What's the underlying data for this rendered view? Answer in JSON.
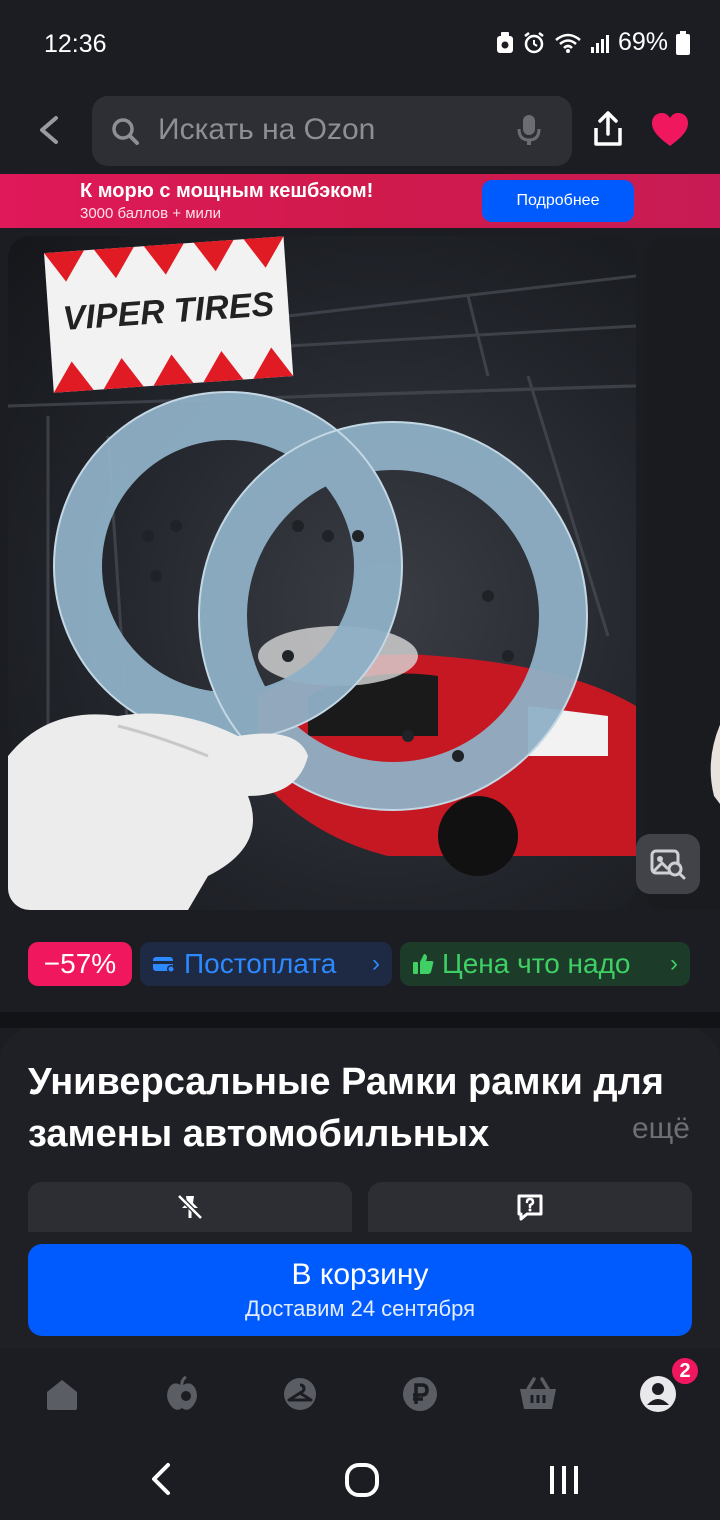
{
  "status_bar": {
    "time": "12:36",
    "battery": "69%"
  },
  "search": {
    "placeholder": "Искать на Ozon"
  },
  "promo": {
    "title": "К морю с мощным кешбэком!",
    "subtitle": "3000 баллов + мили",
    "button": "Подробнее"
  },
  "photo": {
    "brand_sign": "VIPER TIRES"
  },
  "badges": {
    "discount": "−57%",
    "postpay": "Постоплата",
    "price": "Цена что надо"
  },
  "product": {
    "title": "Универсальные Рамки рамки для замены автомобильных",
    "more": "ещё"
  },
  "cart_button": {
    "label": "В корзину",
    "delivery": "Доставим 24 сентября"
  },
  "nav": {
    "profile_badge": "2"
  },
  "colors": {
    "accent": "#005bff",
    "discount": "#f1175e",
    "price_green": "#3ed065",
    "postpay_blue": "#2c89ff"
  }
}
